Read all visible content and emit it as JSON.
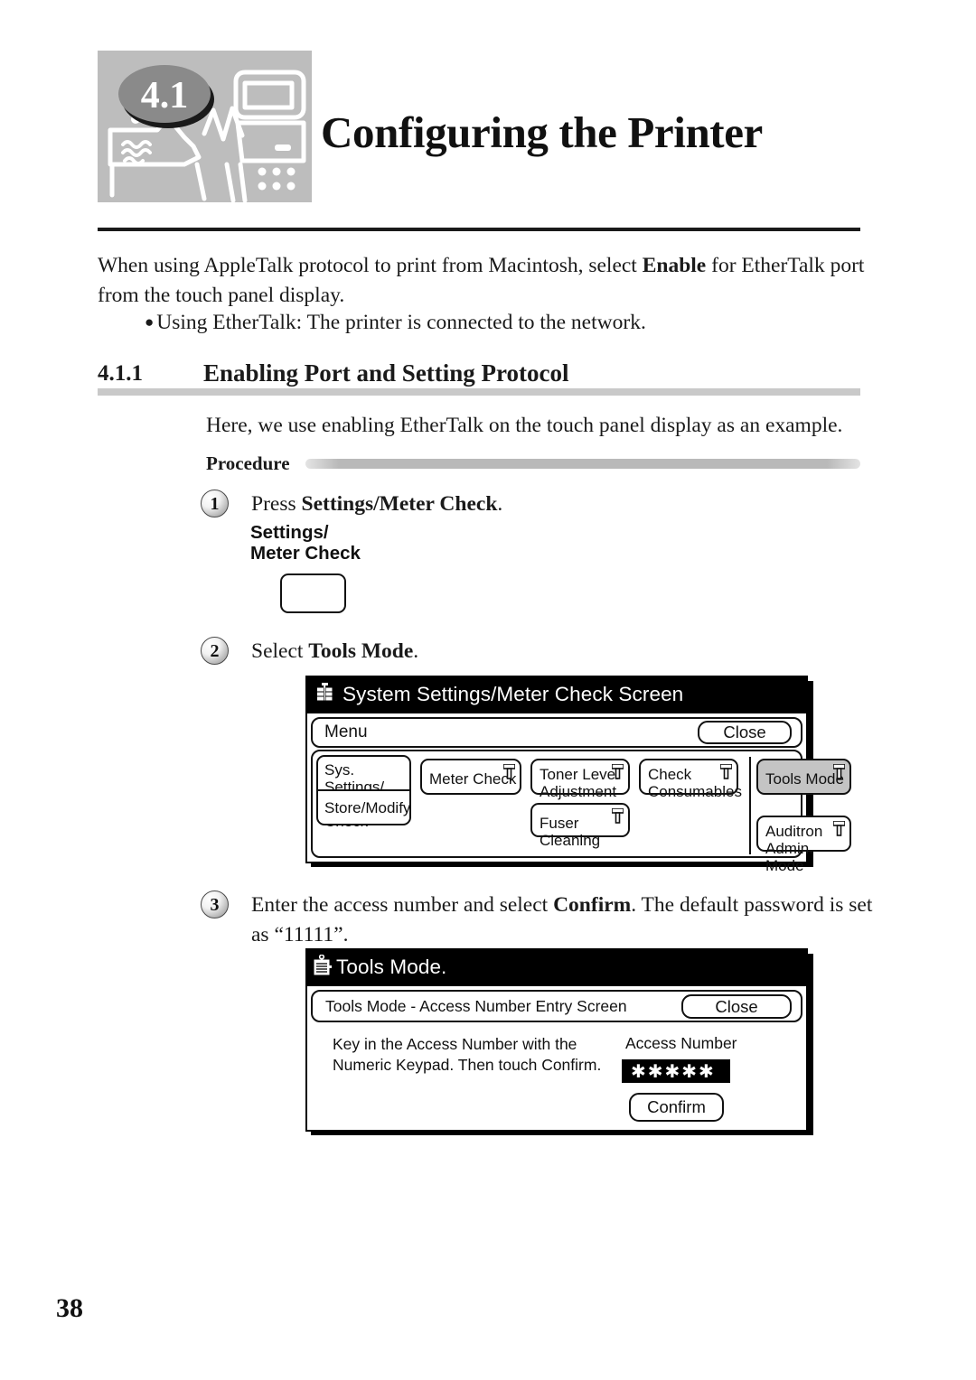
{
  "chapter": {
    "number": "4.1",
    "title": "Configuring the Printer",
    "art_icon": "printer-computer-illustration"
  },
  "intro": {
    "paragraph_pre": "When using AppleTalk protocol to print from Macintosh, select ",
    "paragraph_bold": "Enable",
    "paragraph_post": " for EtherTalk port from the touch panel display.",
    "bullet": "Using EtherTalk: The printer is connected to the network."
  },
  "section": {
    "number": "4.1.1",
    "title": "Enabling Port and Setting Protocol",
    "example": "Here, we use enabling EtherTalk on the touch panel display as an example.",
    "procedure_label": "Procedure"
  },
  "steps": [
    {
      "num": "1",
      "pre": "Press ",
      "bold": "Settings/Meter Check",
      "post": "."
    },
    {
      "num": "2",
      "pre": "Select ",
      "bold": "Tools Mode",
      "post": "."
    },
    {
      "num": "3",
      "pre": "Enter the access number and select ",
      "bold": "Confirm",
      "post": ". The default password is set as “11111”."
    }
  ],
  "hardware_button": {
    "label_line1": "Settings/",
    "label_line2": "Meter Check"
  },
  "panel1": {
    "title": "System Settings/Meter Check Screen",
    "title_icon": "network-tree-icon",
    "menu_label": "Menu",
    "close_label": "Close",
    "left_tabs": [
      {
        "label_line1": "Sys. Settings/",
        "label_line2": "Meter Check"
      },
      {
        "label_line1": "Store/Modify",
        "label_line2": ""
      }
    ],
    "buttons": [
      {
        "label_line1": "Meter Check",
        "label_line2": "",
        "selected": false
      },
      {
        "label_line1": "Toner Level",
        "label_line2": "Adjustment",
        "selected": false
      },
      {
        "label_line1": "Fuser Cleaning",
        "label_line2": "",
        "selected": false
      },
      {
        "label_line1": "Check",
        "label_line2": "Consumables",
        "selected": false
      },
      {
        "label_line1": "Tools Mode",
        "label_line2": "",
        "selected": true
      },
      {
        "label_line1": "Auditron",
        "label_line2": "Admin. Mode",
        "selected": false
      }
    ]
  },
  "panel2": {
    "title": "Tools Mode.",
    "title_icon": "clipboard-key-icon",
    "subbar_label": "Tools Mode  -  Access Number Entry Screen",
    "close_label": "Close",
    "instruction_line1": "Key in the Access Number with the",
    "instruction_line2": "Numeric Keypad.  Then touch Confirm.",
    "field_label": "Access Number",
    "field_value": "✱✱✱✱✱",
    "confirm_label": "Confirm"
  },
  "footer": {
    "page_number": "38"
  }
}
